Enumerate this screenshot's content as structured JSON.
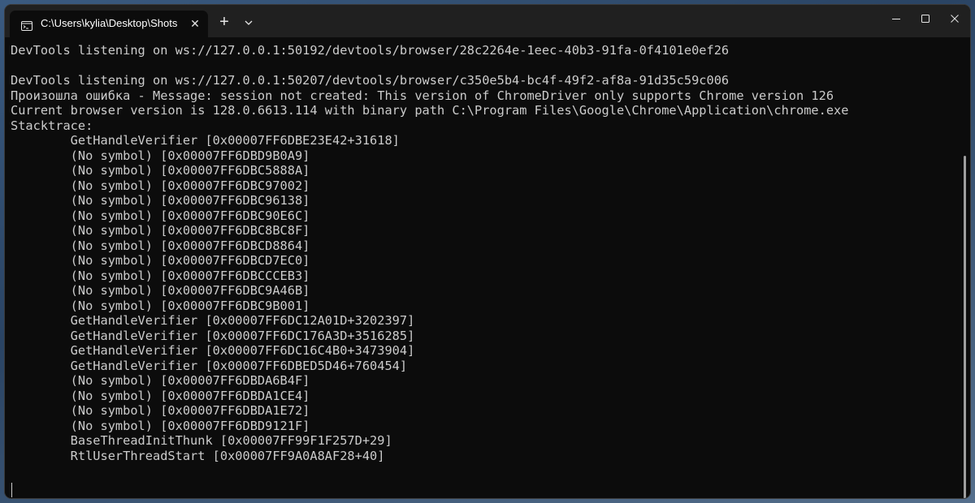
{
  "window": {
    "tab_title": "C:\\Users\\kylia\\Desktop\\Shots",
    "tab_close": "✕",
    "new_tab": "+",
    "icons": {
      "tab": "terminal-icon",
      "dropdown": "chevron-down-icon",
      "minimize": "minimize-icon",
      "maximize": "maximize-icon",
      "close": "close-icon"
    }
  },
  "terminal": {
    "lines": [
      "DevTools listening on ws://127.0.0.1:50192/devtools/browser/28c2264e-1eec-40b3-91fa-0f4101e0ef26",
      "",
      "DevTools listening on ws://127.0.0.1:50207/devtools/browser/c350e5b4-bc4f-49f2-af8a-91d35c59c006",
      "Произошла ошибка - Message: session not created: This version of ChromeDriver only supports Chrome version 126",
      "Current browser version is 128.0.6613.114 with binary path C:\\Program Files\\Google\\Chrome\\Application\\chrome.exe",
      "Stacktrace:",
      "        GetHandleVerifier [0x00007FF6DBE23E42+31618]",
      "        (No symbol) [0x00007FF6DBD9B0A9]",
      "        (No symbol) [0x00007FF6DBC5888A]",
      "        (No symbol) [0x00007FF6DBC97002]",
      "        (No symbol) [0x00007FF6DBC96138]",
      "        (No symbol) [0x00007FF6DBC90E6C]",
      "        (No symbol) [0x00007FF6DBC8BC8F]",
      "        (No symbol) [0x00007FF6DBCD8864]",
      "        (No symbol) [0x00007FF6DBCD7EC0]",
      "        (No symbol) [0x00007FF6DBCCCEB3]",
      "        (No symbol) [0x00007FF6DBC9A46B]",
      "        (No symbol) [0x00007FF6DBC9B001]",
      "        GetHandleVerifier [0x00007FF6DC12A01D+3202397]",
      "        GetHandleVerifier [0x00007FF6DC176A3D+3516285]",
      "        GetHandleVerifier [0x00007FF6DC16C4B0+3473904]",
      "        GetHandleVerifier [0x00007FF6DBED5D46+760454]",
      "        (No symbol) [0x00007FF6DBDA6B4F]",
      "        (No symbol) [0x00007FF6DBDA1CE4]",
      "        (No symbol) [0x00007FF6DBDA1E72]",
      "        (No symbol) [0x00007FF6DBD9121F]",
      "        BaseThreadInitThunk [0x00007FF99F1F257D+29]",
      "        RtlUserThreadStart [0x00007FF9A0A8AF28+40]"
    ]
  },
  "colors": {
    "terminal_bg": "#0c0c0c",
    "titlebar_bg": "#202020",
    "text": "#cccccc"
  }
}
